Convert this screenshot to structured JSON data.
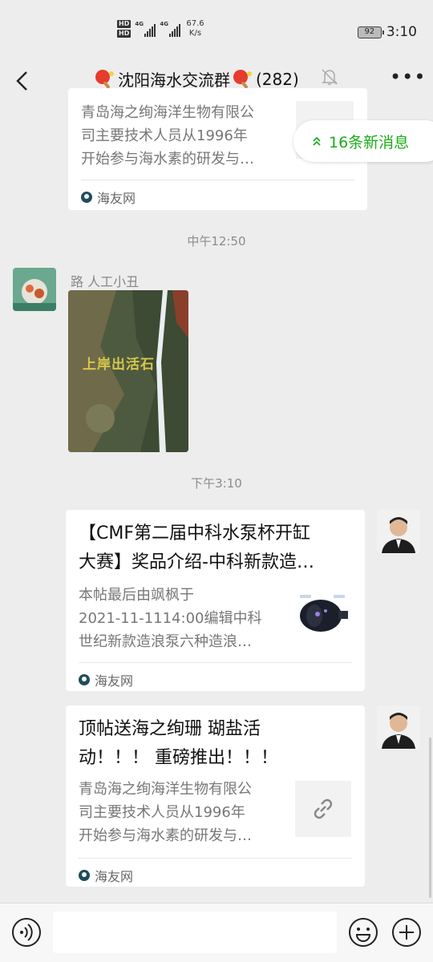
{
  "status_bar": {
    "hd1": "HD",
    "hd2": "HD",
    "net1": "4G",
    "net2": "4G",
    "speed_value": "67.6",
    "speed_unit": "K/s",
    "battery": "92",
    "time": "3:10"
  },
  "header": {
    "title": "沈阳海水交流群",
    "count": "(282)"
  },
  "new_messages": {
    "label": "16条新消息"
  },
  "messages": [
    {
      "desc_lines": [
        "青岛海之绚海洋生物有限公",
        "司主要技术人员从1996年",
        "开始参与海水素的研发与…"
      ],
      "source": "海友网"
    },
    {
      "time": "中午12:50"
    },
    {
      "sender": "路 人工小丑",
      "image_caption": "上岸出活石"
    },
    {
      "time": "下午3:10"
    },
    {
      "title_lines": [
        "【CMF第二届中科水泵杯开缸",
        "大赛】奖品介绍-中科新款造…"
      ],
      "desc_lines": [
        "本帖最后由飒枫于",
        "2021-11-1114:00编辑中科",
        "世纪新款造浪泵六种造浪…"
      ],
      "source": "海友网"
    },
    {
      "title_lines": [
        "顶帖送海之绚珊  瑚盐活",
        "动！！！ 重磅推出！！！"
      ],
      "desc_lines": [
        "青岛海之绚海洋生物有限公",
        "司主要技术人员从1996年",
        "开始参与海水素的研发与…"
      ],
      "source": "海友网"
    }
  ],
  "input": {
    "value": "",
    "placeholder": ""
  },
  "colors": {
    "background": "#ededed",
    "accent_green": "#1aad19",
    "card": "#ffffff"
  },
  "icons": [
    "back-icon",
    "ping-pong-icon",
    "mute-bell-icon",
    "more-icon",
    "double-chevron-up-icon",
    "link-icon",
    "voice-icon",
    "emoji-icon",
    "plus-icon"
  ]
}
